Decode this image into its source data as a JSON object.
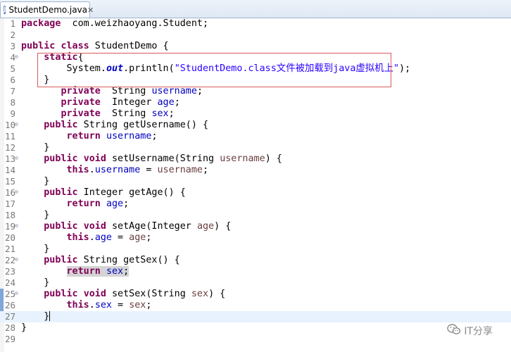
{
  "editor_tab": {
    "title": "StudentDemo.java",
    "icon": "java-file-icon",
    "close": "✕"
  },
  "watermark": "IT分享",
  "code_lines": [
    {
      "n": "1",
      "fold": "",
      "current": false,
      "tokens": [
        [
          "kw",
          "package"
        ],
        [
          "",
          "  com.weizhaoyang.Student;"
        ]
      ]
    },
    {
      "n": "2",
      "fold": "",
      "current": false,
      "tokens": []
    },
    {
      "n": "3",
      "fold": "",
      "current": false,
      "tokens": [
        [
          "kw",
          "public"
        ],
        [
          "",
          " "
        ],
        [
          "kw",
          "class"
        ],
        [
          "",
          " StudentDemo {"
        ]
      ]
    },
    {
      "n": "4",
      "fold": "⊖",
      "current": false,
      "tokens": [
        [
          "",
          "    "
        ],
        [
          "kw",
          "static"
        ],
        [
          "",
          "{"
        ]
      ]
    },
    {
      "n": "5",
      "fold": "",
      "current": false,
      "tokens": [
        [
          "",
          "        System."
        ],
        [
          "sfld",
          "out"
        ],
        [
          "",
          ".println("
        ],
        [
          "str",
          "\"StudentDemo.class文件被加载到java虚拟机上\""
        ],
        [
          "",
          ");"
        ]
      ]
    },
    {
      "n": "6",
      "fold": "",
      "current": false,
      "tokens": [
        [
          "",
          "    }"
        ]
      ]
    },
    {
      "n": "7",
      "fold": "",
      "current": false,
      "tokens": [
        [
          "",
          "       "
        ],
        [
          "kw",
          "private"
        ],
        [
          "",
          "  String "
        ],
        [
          "fld",
          "username"
        ],
        [
          "",
          ";"
        ]
      ]
    },
    {
      "n": "8",
      "fold": "",
      "current": false,
      "tokens": [
        [
          "",
          "       "
        ],
        [
          "kw",
          "private"
        ],
        [
          "",
          "  Integer "
        ],
        [
          "fld",
          "age"
        ],
        [
          "",
          ";"
        ]
      ]
    },
    {
      "n": "9",
      "fold": "",
      "current": false,
      "tokens": [
        [
          "",
          "       "
        ],
        [
          "kw",
          "private"
        ],
        [
          "",
          "  String "
        ],
        [
          "fld",
          "sex"
        ],
        [
          "",
          ";"
        ]
      ]
    },
    {
      "n": "10",
      "fold": "⊖",
      "current": false,
      "tokens": [
        [
          "",
          "    "
        ],
        [
          "kw",
          "public"
        ],
        [
          "",
          " String getUsername() {"
        ]
      ]
    },
    {
      "n": "11",
      "fold": "",
      "current": false,
      "tokens": [
        [
          "",
          "        "
        ],
        [
          "kw",
          "return"
        ],
        [
          "",
          " "
        ],
        [
          "fld",
          "username"
        ],
        [
          "",
          ";"
        ]
      ]
    },
    {
      "n": "12",
      "fold": "",
      "current": false,
      "tokens": [
        [
          "",
          "    }"
        ]
      ]
    },
    {
      "n": "13",
      "fold": "⊖",
      "current": false,
      "tokens": [
        [
          "",
          "    "
        ],
        [
          "kw",
          "public"
        ],
        [
          "",
          " "
        ],
        [
          "kw",
          "void"
        ],
        [
          "",
          " setUsername(String "
        ],
        [
          "prm",
          "username"
        ],
        [
          "",
          ") {"
        ]
      ]
    },
    {
      "n": "14",
      "fold": "",
      "current": false,
      "tokens": [
        [
          "",
          "        "
        ],
        [
          "kw",
          "this"
        ],
        [
          "",
          "."
        ],
        [
          "fld",
          "username"
        ],
        [
          "",
          " = "
        ],
        [
          "prm",
          "username"
        ],
        [
          "",
          ";"
        ]
      ]
    },
    {
      "n": "15",
      "fold": "",
      "current": false,
      "tokens": [
        [
          "",
          "    }"
        ]
      ]
    },
    {
      "n": "16",
      "fold": "⊖",
      "current": false,
      "tokens": [
        [
          "",
          "    "
        ],
        [
          "kw",
          "public"
        ],
        [
          "",
          " Integer getAge() {"
        ]
      ]
    },
    {
      "n": "17",
      "fold": "",
      "current": false,
      "tokens": [
        [
          "",
          "        "
        ],
        [
          "kw",
          "return"
        ],
        [
          "",
          " "
        ],
        [
          "fld",
          "age"
        ],
        [
          "",
          ";"
        ]
      ]
    },
    {
      "n": "18",
      "fold": "",
      "current": false,
      "tokens": [
        [
          "",
          "    }"
        ]
      ]
    },
    {
      "n": "19",
      "fold": "⊖",
      "current": false,
      "tokens": [
        [
          "",
          "    "
        ],
        [
          "kw",
          "public"
        ],
        [
          "",
          " "
        ],
        [
          "kw",
          "void"
        ],
        [
          "",
          " setAge(Integer "
        ],
        [
          "prm",
          "age"
        ],
        [
          "",
          ") {"
        ]
      ]
    },
    {
      "n": "20",
      "fold": "",
      "current": false,
      "tokens": [
        [
          "",
          "        "
        ],
        [
          "kw",
          "this"
        ],
        [
          "",
          "."
        ],
        [
          "fld",
          "age"
        ],
        [
          "",
          " = "
        ],
        [
          "prm",
          "age"
        ],
        [
          "",
          ";"
        ]
      ]
    },
    {
      "n": "21",
      "fold": "",
      "current": false,
      "tokens": [
        [
          "",
          "    }"
        ]
      ]
    },
    {
      "n": "22",
      "fold": "⊖",
      "current": false,
      "tokens": [
        [
          "",
          "    "
        ],
        [
          "kw",
          "public"
        ],
        [
          "",
          " String getSex() {"
        ]
      ]
    },
    {
      "n": "23",
      "fold": "",
      "current": false,
      "tokens": [
        [
          "",
          "        "
        ],
        [
          "kw hl",
          "return"
        ],
        [
          "hl",
          " "
        ],
        [
          "fld hl",
          "sex"
        ],
        [
          "hl",
          ";"
        ]
      ]
    },
    {
      "n": "24",
      "fold": "",
      "current": false,
      "tokens": [
        [
          "",
          "    }"
        ]
      ]
    },
    {
      "n": "25",
      "fold": "⊖",
      "current": false,
      "tokens": [
        [
          "",
          "    "
        ],
        [
          "kw",
          "public"
        ],
        [
          "",
          " "
        ],
        [
          "kw",
          "void"
        ],
        [
          "",
          " setSex(String "
        ],
        [
          "prm",
          "sex"
        ],
        [
          "",
          ") {"
        ]
      ]
    },
    {
      "n": "26",
      "fold": "",
      "current": false,
      "tokens": [
        [
          "",
          "        "
        ],
        [
          "kw",
          "this"
        ],
        [
          "",
          "."
        ],
        [
          "fld",
          "sex"
        ],
        [
          "",
          " = "
        ],
        [
          "prm",
          "sex"
        ],
        [
          "",
          ";"
        ]
      ]
    },
    {
      "n": "27",
      "fold": "",
      "current": true,
      "tokens": [
        [
          "",
          "    }"
        ],
        [
          "caret",
          ""
        ]
      ]
    },
    {
      "n": "28",
      "fold": "",
      "current": false,
      "tokens": [
        [
          "",
          "}"
        ]
      ]
    },
    {
      "n": "29",
      "fold": "",
      "current": false,
      "tokens": []
    }
  ],
  "change_markers": [
    25,
    26,
    27
  ]
}
